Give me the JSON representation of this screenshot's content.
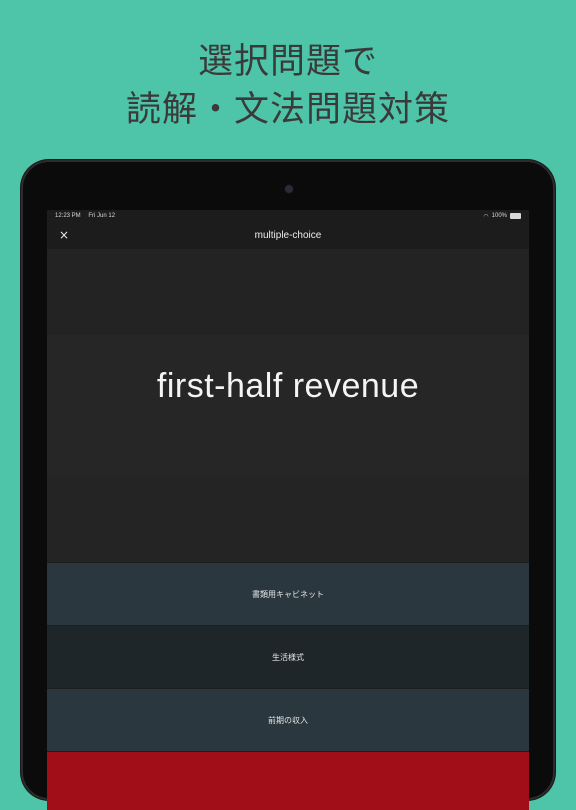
{
  "promo": {
    "line1": "選択問題で",
    "line2": "読解・文法問題対策"
  },
  "status_bar": {
    "time": "12:23 PM",
    "date": "Fri Jun 12",
    "battery": "100%"
  },
  "nav": {
    "title": "multiple-choice",
    "close_icon": "×"
  },
  "question": {
    "term": "first-half revenue"
  },
  "choices": [
    {
      "label": "書類用キャビネット"
    },
    {
      "label": "生活様式"
    },
    {
      "label": "前期の収入"
    },
    {
      "label": ""
    }
  ],
  "colors": {
    "background": "#4ec5a8",
    "choice_blue": "#2a373e",
    "choice_dark": "#1f262a",
    "choice_red": "#a10e18"
  }
}
